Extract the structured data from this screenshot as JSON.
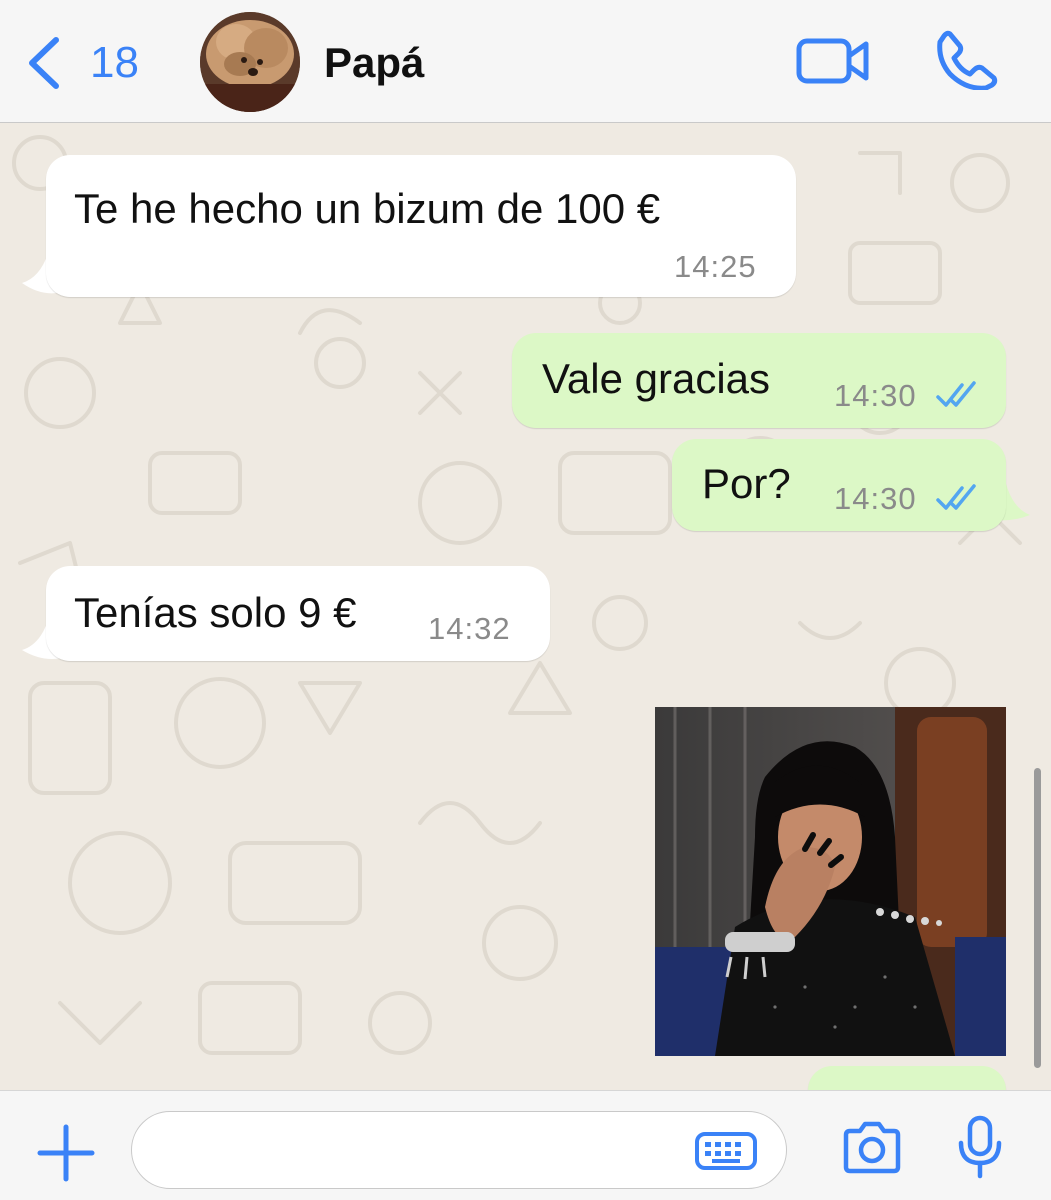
{
  "header": {
    "back_count": "18",
    "contact_name": "Papá"
  },
  "messages": [
    {
      "direction": "incoming",
      "text": "Te he hecho un bizum de 100 €",
      "time": "14:25"
    },
    {
      "direction": "outgoing",
      "text": "Vale gracias",
      "time": "14:30",
      "status": "read"
    },
    {
      "direction": "outgoing",
      "text": "Por?",
      "time": "14:30",
      "status": "read"
    },
    {
      "direction": "incoming",
      "text": "Tenías solo 9 €",
      "time": "14:32"
    },
    {
      "direction": "outgoing",
      "type": "gif"
    }
  ],
  "input": {
    "placeholder": ""
  },
  "colors": {
    "accent": "#3a82f7",
    "incoming_bubble": "#ffffff",
    "outgoing_bubble": "#dcf8c6",
    "chat_background": "#efeae2",
    "read_ticks": "#53a6f0"
  },
  "icons": [
    "back-chevron-icon",
    "video-camera-icon",
    "phone-icon",
    "plus-icon",
    "keyboard-icon",
    "camera-icon",
    "microphone-icon",
    "double-check-icon"
  ]
}
